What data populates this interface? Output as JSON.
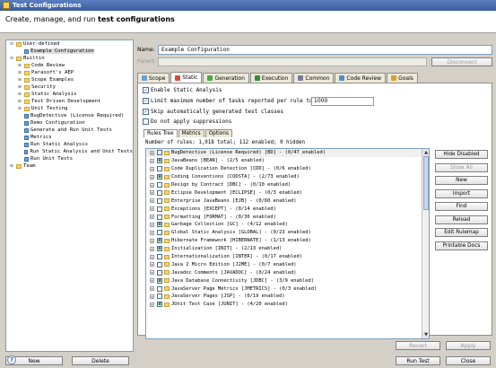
{
  "window": {
    "title": "Test Configurations"
  },
  "header": {
    "prefix": "Create, manage, and run ",
    "bold": "test configurations"
  },
  "tree": {
    "items": [
      {
        "label": "User-defined",
        "indent": 0,
        "toggle": "⊟",
        "icon": "folder"
      },
      {
        "label": "Example Configuration",
        "indent": 1,
        "toggle": "",
        "icon": "config",
        "selected": true
      },
      {
        "label": "Builtin",
        "indent": 0,
        "toggle": "⊟",
        "icon": "folder"
      },
      {
        "label": "Code Review",
        "indent": 1,
        "toggle": "⊞",
        "icon": "folder"
      },
      {
        "label": "Parasoft's AEP",
        "indent": 1,
        "toggle": "⊞",
        "icon": "folder"
      },
      {
        "label": "Scope Examples",
        "indent": 1,
        "toggle": "⊞",
        "icon": "folder"
      },
      {
        "label": "Security",
        "indent": 1,
        "toggle": "⊞",
        "icon": "folder"
      },
      {
        "label": "Static Analysis",
        "indent": 1,
        "toggle": "⊞",
        "icon": "folder"
      },
      {
        "label": "Test Driven Development",
        "indent": 1,
        "toggle": "⊞",
        "icon": "folder"
      },
      {
        "label": "Unit Testing",
        "indent": 1,
        "toggle": "⊞",
        "icon": "folder"
      },
      {
        "label": "BugDetective (License Required)",
        "indent": 1,
        "toggle": "",
        "icon": "config"
      },
      {
        "label": "Demo Configuration",
        "indent": 1,
        "toggle": "",
        "icon": "config"
      },
      {
        "label": "Generate and Run Unit Tests",
        "indent": 1,
        "toggle": "",
        "icon": "config"
      },
      {
        "label": "Metrics",
        "indent": 1,
        "toggle": "",
        "icon": "config"
      },
      {
        "label": "Run Static Analysis",
        "indent": 1,
        "toggle": "",
        "icon": "config"
      },
      {
        "label": "Run Static Analysis and Unit Tests",
        "indent": 1,
        "toggle": "",
        "icon": "config"
      },
      {
        "label": "Run Unit Tests",
        "indent": 1,
        "toggle": "",
        "icon": "config"
      },
      {
        "label": "Team",
        "indent": 0,
        "toggle": "⊞",
        "icon": "folder"
      }
    ]
  },
  "left_buttons": {
    "new": "New",
    "delete": "Delete"
  },
  "config": {
    "name_label": "Name:",
    "name_value": "Example Configuration",
    "parent_label": "Parent:",
    "disconnect": "Disconnect"
  },
  "tabs": [
    {
      "label": "Scope",
      "color": "#6aa0d8"
    },
    {
      "label": "Static",
      "color": "#d94a3a",
      "active": true
    },
    {
      "label": "Generation",
      "color": "#4aa84a"
    },
    {
      "label": "Execution",
      "color": "#3a8a3a"
    },
    {
      "label": "Common",
      "color": "#7a7a9a"
    },
    {
      "label": "Code Review",
      "color": "#5a8ac8"
    },
    {
      "label": "Goals",
      "color": "#d8a030"
    }
  ],
  "static": {
    "enable": "Enable Static Analysis",
    "limit": "Limit maximum number of tasks reported per rule to:",
    "limit_value": "1000",
    "skip": "Skip automatically generated test classes",
    "nosup": "Do not apply suppressions",
    "subtabs": [
      "Rules Tree",
      "Metrics",
      "Options"
    ],
    "rule_count": "Number of rules: 1,018 total; 112 enabled; 0 hidden",
    "rules": [
      {
        "label": "BugDetective (License Required) [BD] - (0/47 enabled)",
        "check": ""
      },
      {
        "label": "JavaBeans [BEAN] - (2/5 enabled)",
        "check": "■"
      },
      {
        "label": "Code Duplication Detection [CDD] - (0/6 enabled)",
        "check": ""
      },
      {
        "label": "Coding Conventions [CODSTA] - (2/73 enabled)",
        "check": "■"
      },
      {
        "label": "Design by Contract [DBC] - (0/10 enabled)",
        "check": ""
      },
      {
        "label": "Eclipse Development [ECLIPSE] - (0/3 enabled)",
        "check": ""
      },
      {
        "label": "Enterprise JavaBeans [EJB] - (0/60 enabled)",
        "check": ""
      },
      {
        "label": "Exceptions [EXCEPT] - (0/14 enabled)",
        "check": ""
      },
      {
        "label": "Formatting [FORMAT] - (0/36 enabled)",
        "check": ""
      },
      {
        "label": "Garbage Collection [GC] - (4/12 enabled)",
        "check": "■"
      },
      {
        "label": "Global Static Analysis [GLOBAL] - (0/23 enabled)",
        "check": ""
      },
      {
        "label": "Hibernate Framework [HIBERNATE] - (1/13 enabled)",
        "check": "■"
      },
      {
        "label": "Initialization [INIT] - (2/13 enabled)",
        "check": "■"
      },
      {
        "label": "Internationalization [INTER] - (0/17 enabled)",
        "check": ""
      },
      {
        "label": "Java 2 Micro Edition [J2ME] - (0/7 enabled)",
        "check": ""
      },
      {
        "label": "Javadoc Comments [JAVADOC] - (0/24 enabled)",
        "check": ""
      },
      {
        "label": "Java Database Connectivity [JDBC] - (3/9 enabled)",
        "check": "■"
      },
      {
        "label": "JavaServer Page Metrics [JMETRICS] - (0/3 enabled)",
        "check": ""
      },
      {
        "label": "JavaServer Pages [JSP] - (0/19 enabled)",
        "check": ""
      },
      {
        "label": "JUnit Test Case [JUNIT] - (4/20 enabled)",
        "check": "■"
      }
    ],
    "side_buttons": [
      {
        "label": "Hide Disabled",
        "disabled": false
      },
      {
        "label": "Show All",
        "disabled": true
      },
      {
        "label": "New",
        "disabled": false
      },
      {
        "label": "Import",
        "disabled": false
      },
      {
        "label": "Find",
        "disabled": false
      },
      {
        "label": "Reload",
        "disabled": false
      },
      {
        "label": "Edit Rulemap",
        "disabled": false
      },
      {
        "label": "Printable Docs",
        "disabled": false
      }
    ]
  },
  "bottom": {
    "revert": "Revert",
    "apply": "Apply",
    "run": "Run Test",
    "close": "Close",
    "help": "?"
  }
}
